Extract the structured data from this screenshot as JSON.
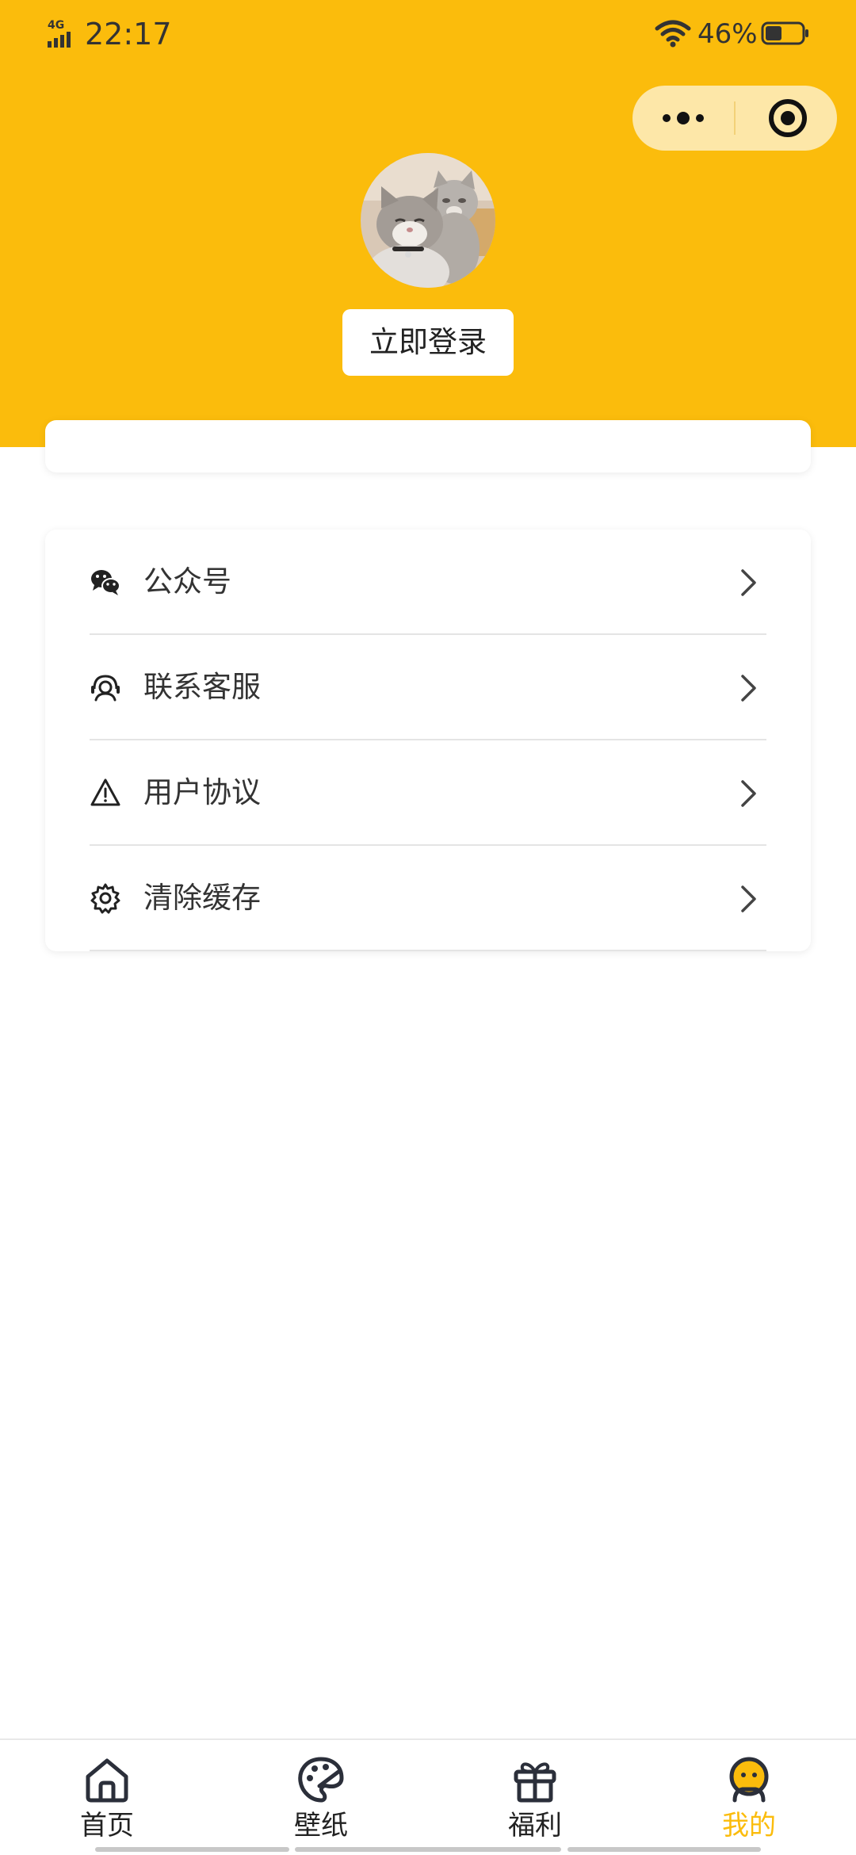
{
  "status_bar": {
    "network": "4G",
    "time": "22:17",
    "battery_percent": "46%",
    "battery_level": 0.46
  },
  "capsule": {
    "menu_icon": "more-dots-icon",
    "close_icon": "target-circle-icon"
  },
  "profile": {
    "avatar_icon": "cat-avatar",
    "login_label": "立即登录"
  },
  "menu": {
    "items": [
      {
        "label": "公众号",
        "icon": "wechat-icon"
      },
      {
        "label": "联系客服",
        "icon": "headset-icon"
      },
      {
        "label": "用户协议",
        "icon": "warning-icon"
      },
      {
        "label": "清除缓存",
        "icon": "gear-icon"
      }
    ]
  },
  "tab_bar": {
    "tabs": [
      {
        "label": "首页",
        "icon": "home-icon",
        "active": false
      },
      {
        "label": "壁纸",
        "icon": "palette-icon",
        "active": false
      },
      {
        "label": "福利",
        "icon": "gift-icon",
        "active": false
      },
      {
        "label": "我的",
        "icon": "user-icon",
        "active": true
      }
    ]
  },
  "colors": {
    "brand_yellow": "#fbbc0c",
    "capsule_bg": "#fde7a8",
    "text_dark": "#222222"
  }
}
